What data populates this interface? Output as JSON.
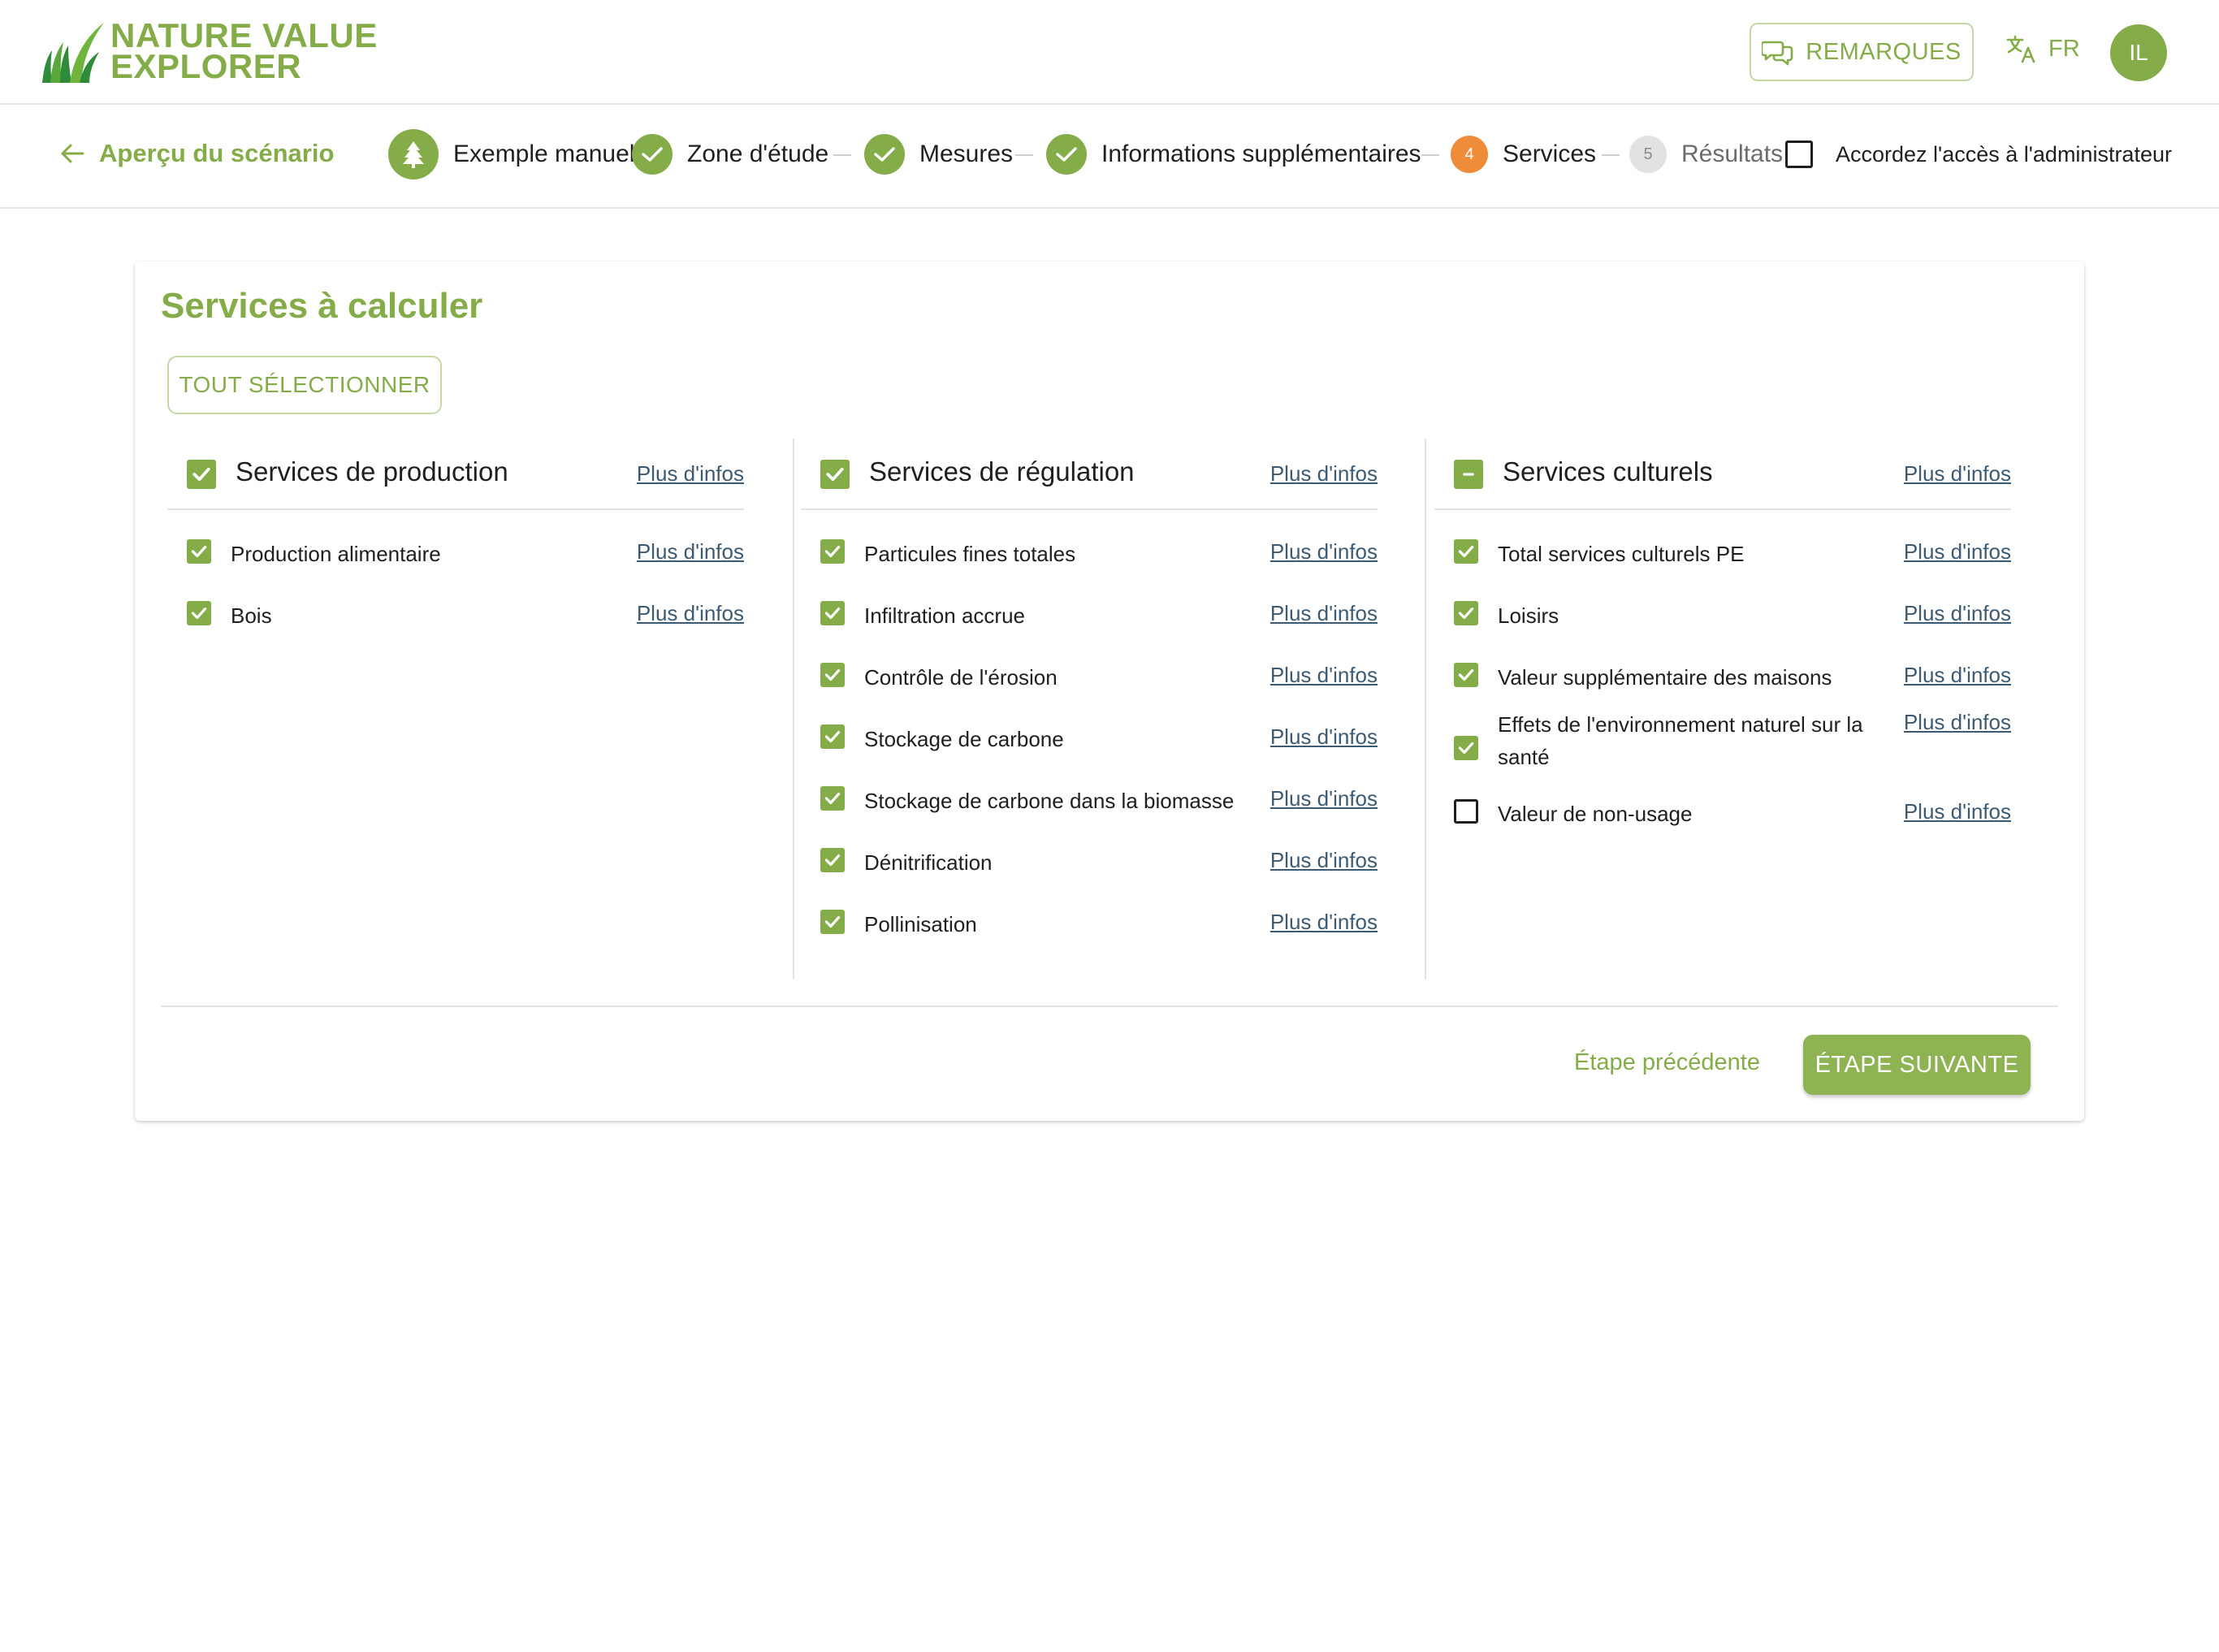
{
  "header": {
    "logo_line1": "NATURE VALUE",
    "logo_line2": "EXPLORER",
    "remarks_label": "REMARQUES",
    "language": "FR",
    "avatar_initials": "IL",
    "brand_color": "#84ac48"
  },
  "stepper": {
    "back_label": "Aperçu du scénario",
    "scenario_label": "Exemple manuel",
    "steps": [
      {
        "label": "Zone d'étude",
        "state": "done"
      },
      {
        "label": "Mesures",
        "state": "done"
      },
      {
        "label": "Informations supplémentaires",
        "state": "done"
      },
      {
        "label": "Services",
        "state": "current",
        "number": "4"
      },
      {
        "label": "Résultats",
        "state": "todo",
        "number": "5"
      }
    ],
    "admin_access_label": "Accordez l'accès à l'administrateur",
    "admin_access_checked": false,
    "current_color": "#ef8c3a"
  },
  "card": {
    "title": "Services à calculer",
    "select_all_label": "TOUT SÉLECTIONNER",
    "more_info_label": "Plus d'infos",
    "columns": [
      {
        "title": "Services de production",
        "state": "checked",
        "items": [
          {
            "label": "Production alimentaire",
            "checked": true
          },
          {
            "label": "Bois",
            "checked": true
          }
        ]
      },
      {
        "title": "Services de régulation",
        "state": "checked",
        "items": [
          {
            "label": "Particules fines totales",
            "checked": true
          },
          {
            "label": "Infiltration accrue",
            "checked": true
          },
          {
            "label": "Contrôle de l'érosion",
            "checked": true
          },
          {
            "label": "Stockage de carbone",
            "checked": true
          },
          {
            "label": "Stockage de carbone dans la biomasse",
            "checked": true
          },
          {
            "label": "Dénitrification",
            "checked": true
          },
          {
            "label": "Pollinisation",
            "checked": true
          }
        ]
      },
      {
        "title": "Services culturels",
        "state": "indeterminate",
        "items": [
          {
            "label": "Total services culturels PE",
            "checked": true
          },
          {
            "label": "Loisirs",
            "checked": true
          },
          {
            "label": "Valeur supplémentaire des maisons",
            "checked": true
          },
          {
            "label": "Effets de l'environnement naturel sur la santé",
            "checked": true
          },
          {
            "label": "Valeur de non-usage",
            "checked": false
          }
        ]
      }
    ],
    "prev_label": "Étape précédente",
    "next_label": "ÉTAPE SUIVANTE"
  }
}
